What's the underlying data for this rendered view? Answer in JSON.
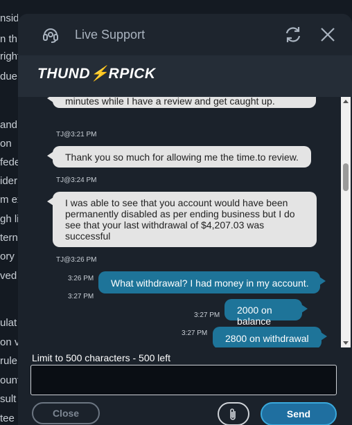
{
  "background_fragments": [
    "nsid",
    "n th",
    "right",
    "due",
    "",
    "and",
    "on",
    "fede",
    "ider",
    "m ex",
    "gh li",
    "tern",
    "ory l",
    "ved",
    "",
    "ulat",
    "on v",
    "rule",
    "ount",
    "sult",
    "tee"
  ],
  "header": {
    "title": "Live Support"
  },
  "brand": {
    "logo_pre": "THUND",
    "logo_bolt": "⚡",
    "logo_post": "RPICK"
  },
  "messages": [
    {
      "from": "agent",
      "text": "minutes while I have a review and get caught up."
    },
    {
      "from": "meta",
      "text": "TJ@3:21 PM"
    },
    {
      "from": "agent",
      "text": "Thank you so much for allowing me the time.to review."
    },
    {
      "from": "meta",
      "text": "TJ@3:24 PM"
    },
    {
      "from": "agent",
      "text": "I was able to see that you account would have been permanently disabled as per ending business but I do see that your last withdrawal of  $4,207.03 was successful"
    },
    {
      "from": "meta",
      "text": "TJ@3:26 PM"
    },
    {
      "from": "user",
      "time": "3:26 PM",
      "text": "What withdrawal? I had money in my account."
    },
    {
      "from": "user_time_only",
      "time": "3:27 PM"
    },
    {
      "from": "user",
      "time": "3:27 PM",
      "text": "2000 on balance"
    },
    {
      "from": "user",
      "time": "3:27 PM",
      "text": "2800 on withdrawal"
    }
  ],
  "composer": {
    "limit_text": "Limit to 500 characters - 500 left",
    "value": "",
    "close_label": "Close",
    "send_label": "Send"
  },
  "colors": {
    "user_bubble": "#1e7499",
    "agent_bubble": "#e4e4e4",
    "accent": "#3aa9dc"
  }
}
